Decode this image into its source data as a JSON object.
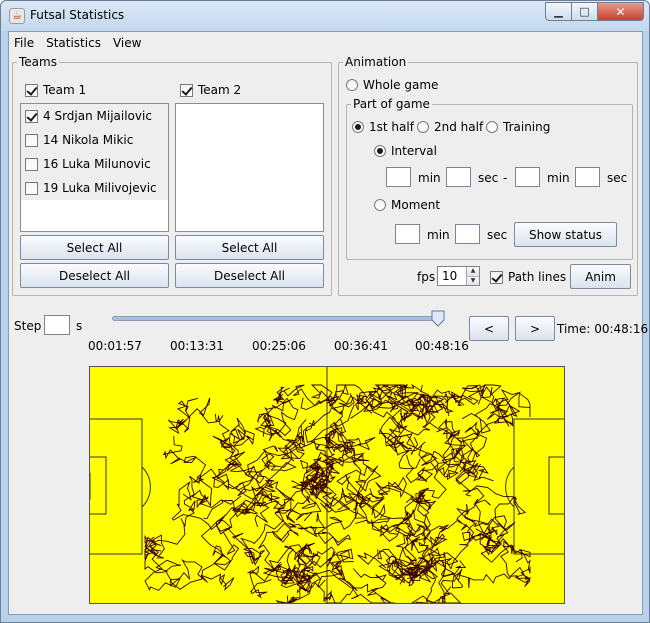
{
  "window": {
    "title": "Futsal Statistics",
    "icon": "java-cup-icon"
  },
  "menu": [
    "File",
    "Statistics",
    "View"
  ],
  "teams": {
    "title": "Teams",
    "team1": {
      "label": "Team 1",
      "checked": true
    },
    "team2": {
      "label": "Team 2",
      "checked": true
    },
    "players_team1": [
      {
        "label": "4 Srdjan Mijailovic",
        "checked": true
      },
      {
        "label": "14 Nikola Mikic",
        "checked": false
      },
      {
        "label": "16 Luka Milunovic",
        "checked": false
      },
      {
        "label": "19 Luka Milivojevic",
        "checked": false
      }
    ],
    "select_all": "Select All",
    "deselect_all": "Deselect All"
  },
  "animation": {
    "title": "Animation",
    "whole_game": "Whole game",
    "part_of_game": "Part of game",
    "first_half": "1st half",
    "second_half": "2nd half",
    "training": "Training",
    "interval": "Interval",
    "moment": "Moment",
    "min": "min",
    "sec": "sec",
    "dash": "-",
    "show_status": "Show status",
    "fps_label": "fps",
    "fps_value": "10",
    "path_lines": "Path lines",
    "path_lines_checked": true,
    "anim": "Anim"
  },
  "timeline": {
    "step_label": "Step",
    "step_unit": "s",
    "ticks": [
      "00:01:57",
      "00:13:31",
      "00:25:06",
      "00:36:41",
      "00:48:16"
    ],
    "slider_fraction": 1.0,
    "prev": "<",
    "next": ">",
    "time_label": "Time: 00:48:16"
  },
  "pitch": {
    "background": "#ffff00",
    "lines": "#333333",
    "path_color": "#3a0000"
  }
}
